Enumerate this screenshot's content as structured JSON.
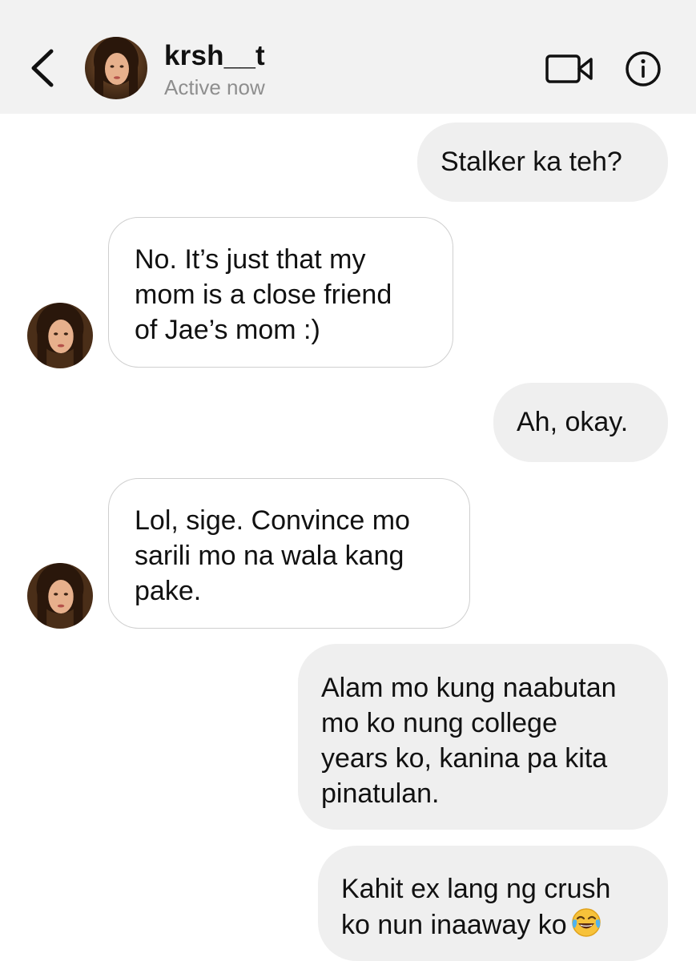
{
  "header": {
    "back_icon": "chevron-left-icon",
    "username": "krsh__t",
    "status": "Active now",
    "video_icon": "video-camera-icon",
    "info_icon": "info-icon",
    "background": "#f2f2f2"
  },
  "messages": [
    {
      "direction": "outgoing",
      "lines": [
        "Stalker ka teh?"
      ]
    },
    {
      "direction": "incoming",
      "lines": [
        "No. It’s just that my",
        "mom is a close friend",
        "of Jae’s mom :)"
      ]
    },
    {
      "direction": "outgoing",
      "lines": [
        "Ah, okay."
      ]
    },
    {
      "direction": "incoming",
      "lines": [
        "Lol, sige. Convince mo",
        "sarili mo na wala kang",
        "pake."
      ]
    },
    {
      "direction": "outgoing",
      "lines": [
        "Alam mo kung naabutan",
        "mo ko nung college",
        "years ko, kanina pa kita",
        "pinatulan."
      ]
    },
    {
      "direction": "outgoing",
      "lines": [
        "Kahit ex lang ng crush",
        "ko nun inaaway ko"
      ],
      "emoji": "face-with-tears-of-joy-icon"
    }
  ],
  "colors": {
    "outgoing_bubble": "#efefef",
    "incoming_border": "#cfcfcf",
    "status_text": "#8e8e8e"
  }
}
